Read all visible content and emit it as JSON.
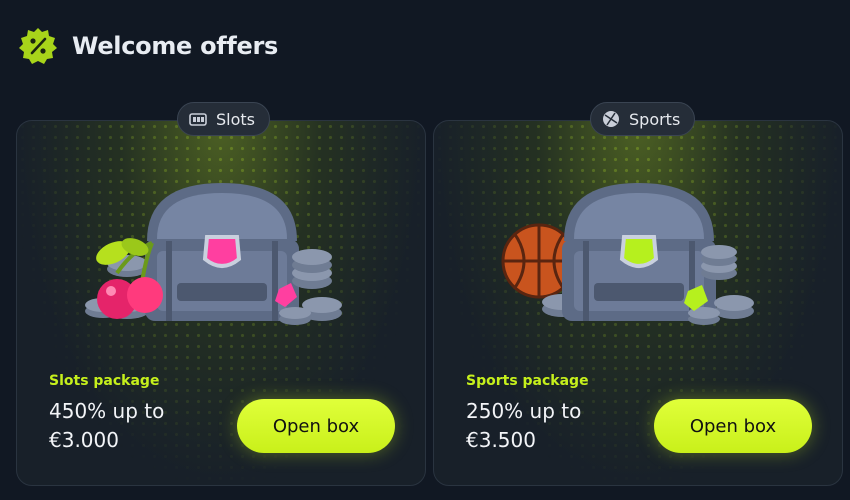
{
  "header": {
    "title": "Welcome offers",
    "badge_icon": "percent-badge-icon"
  },
  "offers": [
    {
      "category": "Slots",
      "category_icon": "slot-machine-icon",
      "package": "Slots package",
      "amount_line1": "450% up to",
      "amount_line2": "€3.000",
      "button": "Open box",
      "gem_color": "#ff3fa0"
    },
    {
      "category": "Sports",
      "category_icon": "ball-icon",
      "package": "Sports package",
      "amount_line1": "250% up to",
      "amount_line2": "€3.500",
      "button": "Open box",
      "gem_color": "#b6f01e"
    }
  ],
  "colors": {
    "accent": "#c6f01c",
    "background": "#111823",
    "card": "#182029"
  }
}
